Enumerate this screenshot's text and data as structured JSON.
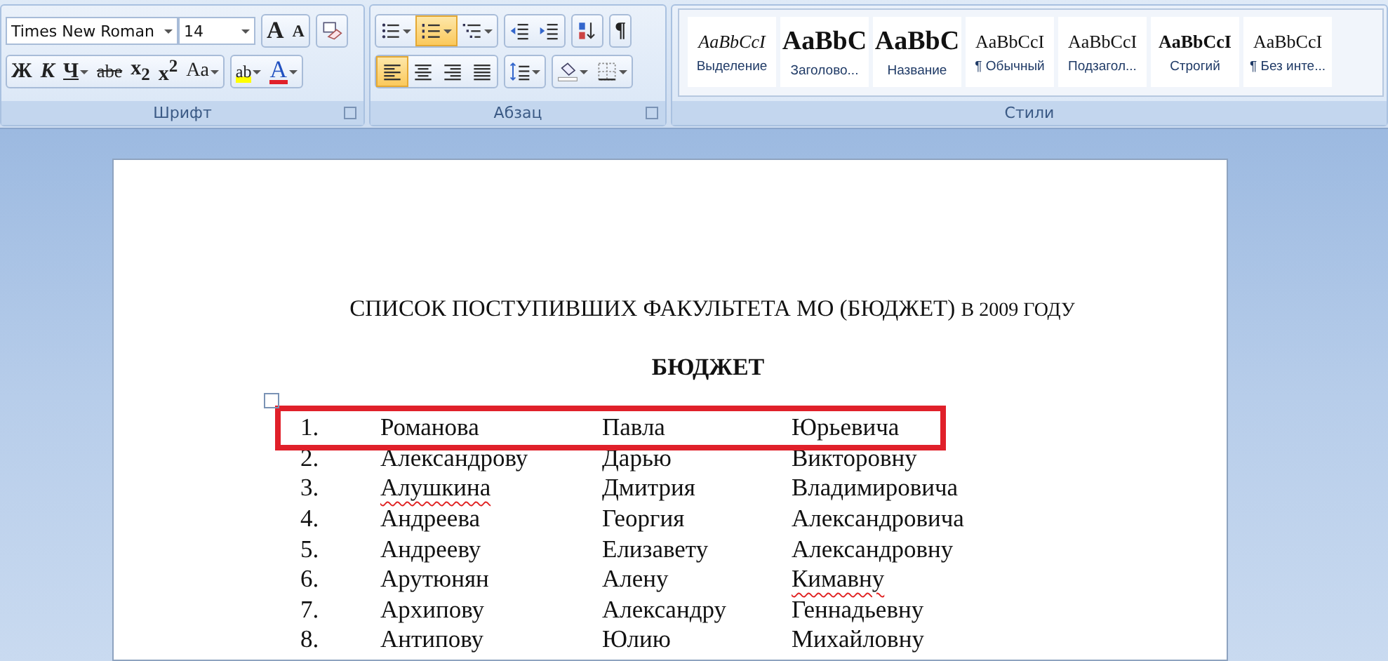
{
  "ribbon": {
    "groups": [
      {
        "kind": "font",
        "label": "Шрифт",
        "font_name": "Times New Roman",
        "font_size": "14",
        "rows": [
          {
            "segments": [
              {
                "buttons": [
                  {
                    "kind": "grow",
                    "label": "A",
                    "selected": false,
                    "dropdown": false
                  },
                  {
                    "kind": "shrink",
                    "label": "A",
                    "selected": false,
                    "dropdown": false
                  }
                ]
              },
              {
                "buttons": [
                  {
                    "kind": "clear",
                    "selected": false,
                    "dropdown": false
                  }
                ]
              }
            ]
          },
          {
            "segments": [
              {
                "buttons": [
                  {
                    "kind": "bold",
                    "label": "Ж",
                    "selected": false,
                    "dropdown": false
                  },
                  {
                    "kind": "italic",
                    "label": "К",
                    "selected": false,
                    "dropdown": false
                  },
                  {
                    "kind": "underline",
                    "label": "Ч",
                    "selected": false,
                    "dropdown": true
                  },
                  {
                    "kind": "strike",
                    "label": "abe",
                    "selected": false,
                    "dropdown": false
                  },
                  {
                    "kind": "text",
                    "label": "x$_{2}$",
                    "selected": false,
                    "dropdown": false
                  },
                  {
                    "kind": "text",
                    "label": "x$^{2}$",
                    "selected": false,
                    "dropdown": false
                  },
                  {
                    "kind": "case",
                    "label": "Aa",
                    "selected": false,
                    "dropdown": true
                  }
                ]
              },
              {
                "buttons": [
                  {
                    "kind": "highlight",
                    "label": "ab",
                    "selected": false,
                    "dropdown": true
                  },
                  {
                    "kind": "fontcolor",
                    "label": "A",
                    "selected": false,
                    "dropdown": true
                  }
                ]
              }
            ]
          }
        ]
      },
      {
        "kind": "paragraph",
        "label": "Абзац",
        "rows": [
          {
            "segments": [
              {
                "buttons": [
                  {
                    "kind": "bullets",
                    "selected": false,
                    "dropdown": true
                  },
                  {
                    "kind": "numbering",
                    "selected": true,
                    "dropdown": true
                  },
                  {
                    "kind": "multilevel",
                    "selected": false,
                    "dropdown": true
                  }
                ]
              },
              {
                "buttons": [
                  {
                    "kind": "outdent",
                    "selected": false,
                    "dropdown": false
                  },
                  {
                    "kind": "indent",
                    "selected": false,
                    "dropdown": false
                  }
                ]
              },
              {
                "buttons": [
                  {
                    "kind": "sort",
                    "selected": false,
                    "dropdown": false
                  }
                ]
              },
              {
                "buttons": [
                  {
                    "kind": "text",
                    "label": "¶",
                    "selected": false,
                    "dropdown": false
                  }
                ]
              }
            ]
          },
          {
            "segments": [
              {
                "buttons": [
                  {
                    "kind": "align-left",
                    "selected": true,
                    "dropdown": false
                  },
                  {
                    "kind": "align-center",
                    "selected": false,
                    "dropdown": false
                  },
                  {
                    "kind": "align-right",
                    "selected": false,
                    "dropdown": false
                  },
                  {
                    "kind": "justify",
                    "selected": false,
                    "dropdown": false
                  }
                ]
              },
              {
                "buttons": [
                  {
                    "kind": "spacing",
                    "selected": false,
                    "dropdown": true
                  }
                ]
              },
              {
                "buttons": [
                  {
                    "kind": "shading",
                    "selected": false,
                    "dropdown": true
                  },
                  {
                    "kind": "borders",
                    "selected": false,
                    "dropdown": true
                  }
                ]
              }
            ]
          }
        ]
      },
      {
        "kind": "styles",
        "label": "Стили",
        "styles": [
          {
            "kind": "emphasis",
            "preview": "AaBbCcI",
            "name": "Выделение"
          },
          {
            "kind": "heading",
            "preview": "AaBbC",
            "name": "Заголово..."
          },
          {
            "kind": "title",
            "preview": "AaBbC",
            "name": "Название"
          },
          {
            "kind": "normal",
            "preview": "AaBbCcI",
            "name": "¶ Обычный"
          },
          {
            "kind": "normal",
            "preview": "AaBbCcI",
            "name": "Подзагол..."
          },
          {
            "kind": "strong",
            "preview": "AaBbCcI",
            "name": "Строгий"
          },
          {
            "kind": "normal",
            "preview": "AaBbCcI",
            "name": "¶ Без инте..."
          }
        ]
      }
    ]
  },
  "document": {
    "title": "СПИСОК ПОСТУПИВШИХ ФАКУЛЬТЕТА МО (БЮДЖЕТ)",
    "title_tail": "В 2009 ГОДУ",
    "heading": "БЮДЖЕТ",
    "rows": [
      {
        "number": "1.",
        "highlighted": true,
        "cells": [
          {
            "text": "Романова",
            "misspelled": false
          },
          {
            "text": "Павла",
            "misspelled": false
          },
          {
            "text": "Юрьевича",
            "misspelled": false
          }
        ]
      },
      {
        "number": "2.",
        "highlighted": false,
        "cells": [
          {
            "text": "Александрову",
            "misspelled": false
          },
          {
            "text": "Дарью",
            "misspelled": false
          },
          {
            "text": "Викторовну",
            "misspelled": false
          }
        ]
      },
      {
        "number": "3.",
        "highlighted": false,
        "cells": [
          {
            "text": "Алушкина",
            "misspelled": true
          },
          {
            "text": "Дмитрия",
            "misspelled": false
          },
          {
            "text": "Владимировича",
            "misspelled": false
          }
        ]
      },
      {
        "number": "4.",
        "highlighted": false,
        "cells": [
          {
            "text": "Андреева",
            "misspelled": false
          },
          {
            "text": "Георгия",
            "misspelled": false
          },
          {
            "text": "Александровича",
            "misspelled": false
          }
        ]
      },
      {
        "number": "5.",
        "highlighted": false,
        "cells": [
          {
            "text": "Андрееву",
            "misspelled": false
          },
          {
            "text": "Елизавету",
            "misspelled": false
          },
          {
            "text": "Александровну",
            "misspelled": false
          }
        ]
      },
      {
        "number": "6.",
        "highlighted": false,
        "cells": [
          {
            "text": "Арутюнян",
            "misspelled": false
          },
          {
            "text": "Алену",
            "misspelled": false
          },
          {
            "text": "Кимавну",
            "misspelled": true
          }
        ]
      },
      {
        "number": "7.",
        "highlighted": false,
        "cells": [
          {
            "text": "Архипову",
            "misspelled": false
          },
          {
            "text": "Александру",
            "misspelled": false
          },
          {
            "text": "Геннадьевну",
            "misspelled": false
          }
        ]
      },
      {
        "number": "8.",
        "highlighted": false,
        "cells": [
          {
            "text": "Антипову",
            "misspelled": false
          },
          {
            "text": "Юлию",
            "misspelled": false
          },
          {
            "text": "Михайловну",
            "misspelled": false
          }
        ]
      }
    ]
  }
}
